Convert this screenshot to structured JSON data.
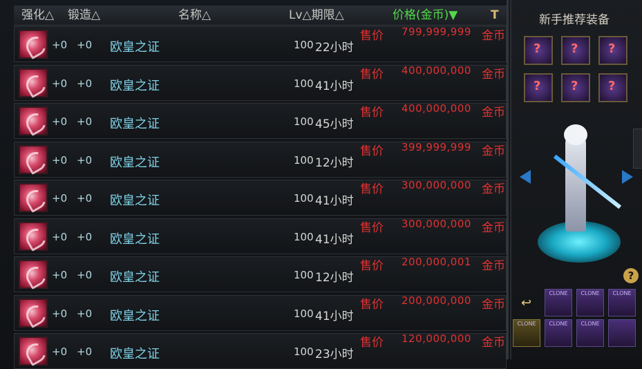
{
  "header": {
    "enhance": "强化△",
    "forge": "锻造△",
    "name": "名称△",
    "lv_period": "Lv△期限△",
    "price": "价格(金币)▼",
    "sort_icon": "hammer-icon"
  },
  "listings": [
    {
      "enhance": "+0",
      "forge": "+0",
      "name": "欧皇之证",
      "lv": "100",
      "period": "22小时",
      "price_tag": "售价",
      "price": "799,999,999",
      "currency": "金币"
    },
    {
      "enhance": "+0",
      "forge": "+0",
      "name": "欧皇之证",
      "lv": "100",
      "period": "41小时",
      "price_tag": "售价",
      "price": "400,000,000",
      "currency": "金币"
    },
    {
      "enhance": "+0",
      "forge": "+0",
      "name": "欧皇之证",
      "lv": "100",
      "period": "45小时",
      "price_tag": "售价",
      "price": "400,000,000",
      "currency": "金币"
    },
    {
      "enhance": "+0",
      "forge": "+0",
      "name": "欧皇之证",
      "lv": "100",
      "period": "12小时",
      "price_tag": "售价",
      "price": "399,999,999",
      "currency": "金币"
    },
    {
      "enhance": "+0",
      "forge": "+0",
      "name": "欧皇之证",
      "lv": "100",
      "period": "41小时",
      "price_tag": "售价",
      "price": "300,000,000",
      "currency": "金币"
    },
    {
      "enhance": "+0",
      "forge": "+0",
      "name": "欧皇之证",
      "lv": "100",
      "period": "41小时",
      "price_tag": "售价",
      "price": "300,000,000",
      "currency": "金币"
    },
    {
      "enhance": "+0",
      "forge": "+0",
      "name": "欧皇之证",
      "lv": "100",
      "period": "12小时",
      "price_tag": "售价",
      "price": "200,000,001",
      "currency": "金币"
    },
    {
      "enhance": "+0",
      "forge": "+0",
      "name": "欧皇之证",
      "lv": "100",
      "period": "41小时",
      "price_tag": "售价",
      "price": "200,000,000",
      "currency": "金币"
    },
    {
      "enhance": "+0",
      "forge": "+0",
      "name": "欧皇之证",
      "lv": "100",
      "period": "23小时",
      "price_tag": "售价",
      "price": "120,000,000",
      "currency": "金币"
    }
  ],
  "side_panel": {
    "title": "新手推荐装备",
    "help": "?",
    "back": "↩",
    "clone_label": "CLONE"
  },
  "colors": {
    "price_red": "#e23232",
    "name_cyan": "#7ed2e8",
    "header_green": "#52d84a"
  }
}
